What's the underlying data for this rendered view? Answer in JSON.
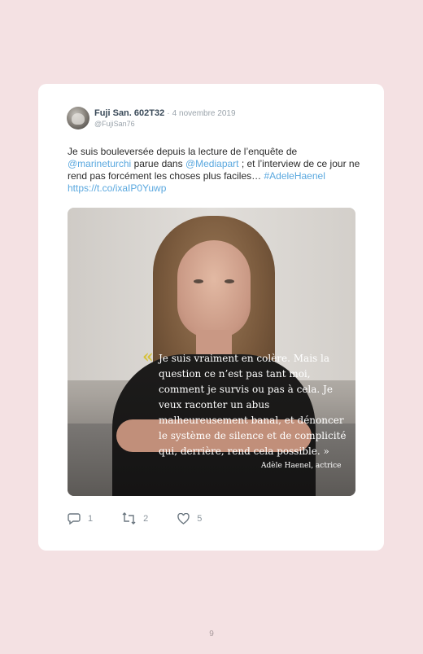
{
  "tweet": {
    "display_name": "Fuji San. 602T32",
    "separator": "·",
    "date": "4 novembre 2019",
    "handle": "@FujiSan76",
    "text_parts": {
      "p1": "Je suis bouleversée depuis la lecture de l’enquête de",
      "mention1": "@marineturchi",
      "p2": "parue dans",
      "mention2": "@Mediapart",
      "p3": "; et l’interview de ce jour ne rend pas forcément les choses plus faciles…",
      "hashtag": "#AdeleHaenel",
      "url": "https://t.co/ixaIP0Yuwp"
    },
    "image": {
      "quote_mark": "«",
      "quote_text": "Je suis vraiment en colère. Mais la question ce n’est pas tant moi, comment je survis ou pas à cela. Je veux raconter un abus malheureusement banal, et dénoncer le système de silence et de complicité qui, derrière, rend cela possible. »",
      "attribution": "Adèle Haenel, actrice"
    },
    "actions": {
      "replies": "1",
      "retweets": "2",
      "likes": "5"
    }
  },
  "colors": {
    "page_background": "#f4e1e3",
    "card_background": "#ffffff",
    "link": "#5aa8df",
    "quote_mark": "#d6c23f"
  },
  "icons": [
    "reply-icon",
    "retweet-icon",
    "heart-icon"
  ],
  "page": {
    "number": "9"
  }
}
